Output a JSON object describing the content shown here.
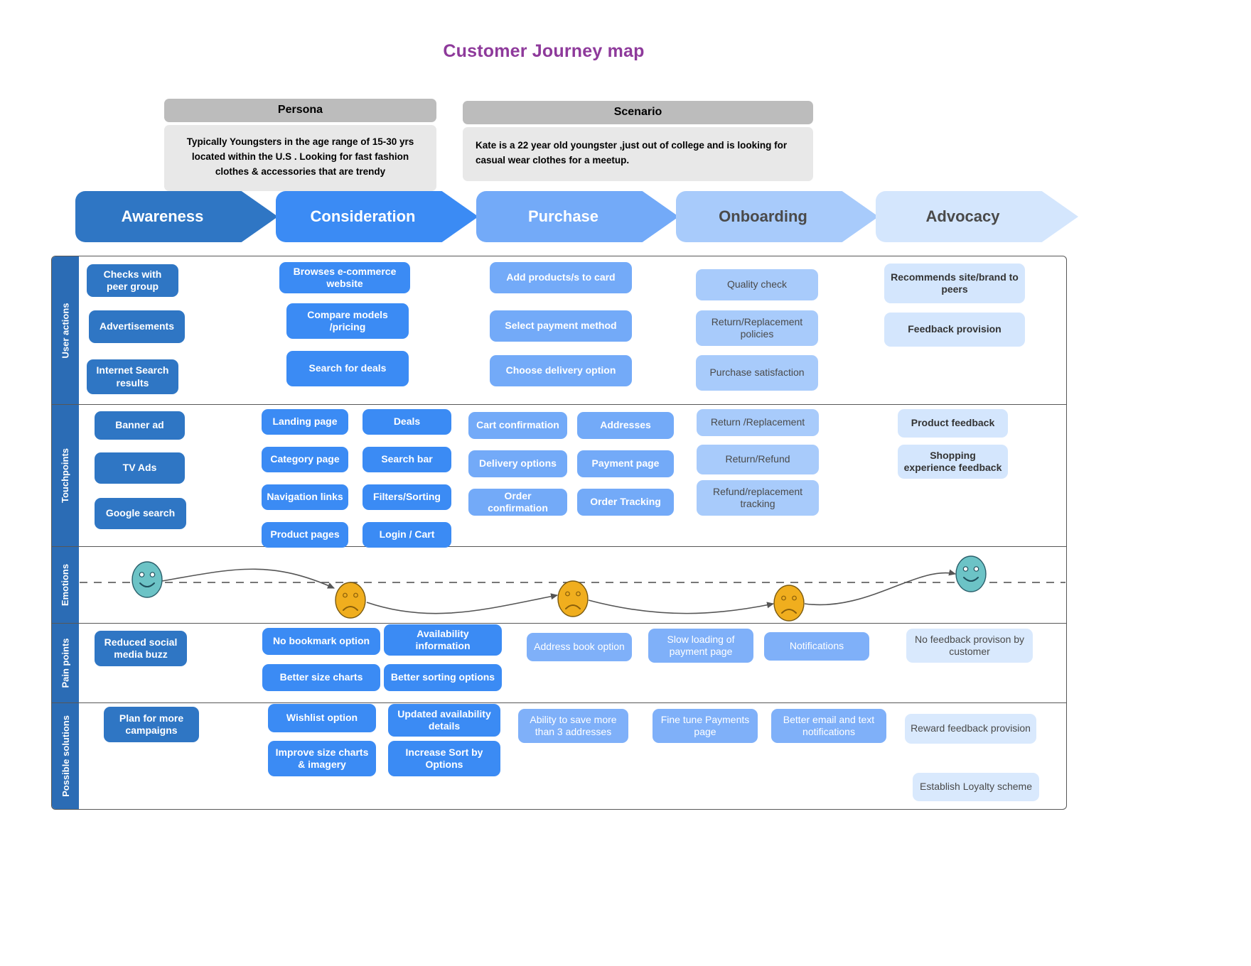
{
  "title": "Customer Journey map",
  "persona": {
    "heading": "Persona",
    "text": "Typically Youngsters in the age range of 15-30 yrs located within the U.S . Looking for fast fashion clothes & accessories that are trendy"
  },
  "scenario": {
    "heading": "Scenario",
    "text": "Kate is a 22 year old youngster ,just out of college and is looking for casual wear clothes for a meetup."
  },
  "stages": [
    {
      "label": "Awareness",
      "color": "#2f76c4",
      "text_color": "#ffffff"
    },
    {
      "label": "Consideration",
      "color": "#3b8bf4",
      "text_color": "#ffffff"
    },
    {
      "label": "Purchase",
      "color": "#73aaf8",
      "text_color": "#ffffff"
    },
    {
      "label": "Onboarding",
      "color": "#a8cbfb",
      "text_color": "#4a4a4a"
    },
    {
      "label": "Advocacy",
      "color": "#d4e6fd",
      "text_color": "#4a4a4a"
    }
  ],
  "rows": [
    {
      "label": "User actions"
    },
    {
      "label": "Touchpoints"
    },
    {
      "label": "Emotions"
    },
    {
      "label": "Pain points"
    },
    {
      "label": "Possible solutions"
    }
  ],
  "user_actions": {
    "awareness": [
      "Checks with peer group",
      "Advertisements",
      "Internet Search results"
    ],
    "consideration": [
      "Browses e-commerce website",
      "Compare models /pricing",
      "Search for deals"
    ],
    "purchase": [
      "Add products/s to card",
      "Select payment method",
      "Choose delivery option"
    ],
    "onboarding": [
      "Quality check",
      "Return/Replacement policies",
      "Purchase satisfaction"
    ],
    "advocacy": [
      "Recommends site/brand to peers",
      "Feedback provision"
    ]
  },
  "touchpoints": {
    "awareness": [
      "Banner ad",
      "TV Ads",
      "Google  search"
    ],
    "consideration_a": [
      "Landing page",
      "Category page",
      "Navigation links",
      "Product pages"
    ],
    "consideration_b": [
      "Deals",
      "Search bar",
      "Filters/Sorting",
      "Login / Cart"
    ],
    "purchase_a": [
      "Cart confirmation",
      "Delivery options",
      "Order confirmation"
    ],
    "purchase_b": [
      "Addresses",
      "Payment page",
      "Order Tracking"
    ],
    "onboarding": [
      "Return /Replacement",
      "Return/Refund",
      "Refund/replacement tracking"
    ],
    "advocacy": [
      "Product feedback",
      "Shopping experience feedback"
    ]
  },
  "emotions": {
    "baseline_label": "neutral",
    "points": [
      {
        "stage": "Awareness",
        "mood": "happy",
        "face": "smile",
        "color": "#6cc3c6"
      },
      {
        "stage": "Consideration",
        "mood": "sad",
        "face": "frown",
        "color": "#f0ae1e"
      },
      {
        "stage": "Purchase",
        "mood": "sad",
        "face": "frown",
        "color": "#f0ae1e"
      },
      {
        "stage": "Onboarding",
        "mood": "sad",
        "face": "frown",
        "color": "#f0ae1e"
      },
      {
        "stage": "Advocacy",
        "mood": "happy",
        "face": "smile",
        "color": "#6cc3c6"
      }
    ]
  },
  "pain_points": {
    "awareness": [
      "Reduced social media buzz"
    ],
    "consideration_a": [
      "No bookmark option",
      "Better size charts"
    ],
    "consideration_b": [
      "Availability information",
      "Better sorting options"
    ],
    "purchase_a": [
      "Address book option"
    ],
    "purchase_b": [
      "Slow loading of payment page"
    ],
    "purchase_c": [
      "Notifications"
    ],
    "advocacy": [
      "No feedback provison by customer"
    ]
  },
  "possible_solutions": {
    "awareness": [
      "Plan for more campaigns"
    ],
    "consideration_a": [
      "Wishlist option",
      "Improve size charts & imagery"
    ],
    "consideration_b": [
      "Updated availability details",
      "Increase Sort by Options"
    ],
    "purchase_a": [
      "Ability to save more than 3 addresses"
    ],
    "purchase_b": [
      "Fine tune Payments page"
    ],
    "purchase_c": [
      "Better email and text notifications"
    ],
    "advocacy": [
      "Reward feedback provision",
      "Establish Loyalty scheme"
    ]
  }
}
